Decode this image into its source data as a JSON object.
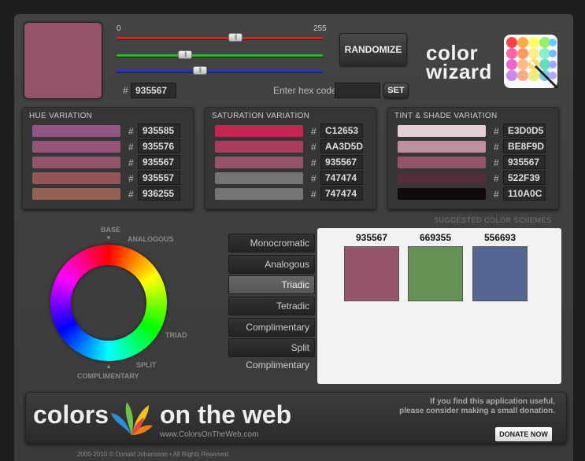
{
  "current": {
    "hex": "935567",
    "color": "#935567"
  },
  "sliders": {
    "min_label": "0",
    "max_label": "255",
    "thumb_glyph": "|||",
    "red": 147,
    "green": 85,
    "blue": 103,
    "colors": {
      "red": "#e02020",
      "green": "#20c020",
      "blue": "#2030d0"
    }
  },
  "controls": {
    "hash": "#",
    "randomize_label": "RANDOMIZE",
    "hex_entry_label": "Enter hex code:",
    "hex_entry_value": "",
    "set_label": "SET"
  },
  "logo": {
    "line1": "color",
    "line2": "wizard"
  },
  "panels": [
    {
      "title": "HUE VARIATION",
      "rows": [
        {
          "hex": "935585",
          "color": "#935585"
        },
        {
          "hex": "935576",
          "color": "#935576"
        },
        {
          "hex": "935567",
          "color": "#935567"
        },
        {
          "hex": "935557",
          "color": "#935557"
        },
        {
          "hex": "936255",
          "color": "#936255"
        }
      ]
    },
    {
      "title": "SATURATION VARIATION",
      "rows": [
        {
          "hex": "C12653",
          "color": "#C12653"
        },
        {
          "hex": "AA3D5D",
          "color": "#AA3D5D"
        },
        {
          "hex": "935567",
          "color": "#935567"
        },
        {
          "hex": "747474",
          "color": "#747474"
        },
        {
          "hex": "747474",
          "color": "#747474"
        }
      ]
    },
    {
      "title": "TINT & SHADE VARIATION",
      "rows": [
        {
          "hex": "E3D0D5",
          "color": "#E3D0D5"
        },
        {
          "hex": "BE8F9D",
          "color": "#BE8F9D"
        },
        {
          "hex": "935567",
          "color": "#935567"
        },
        {
          "hex": "522F39",
          "color": "#522F39"
        },
        {
          "hex": "110A0C",
          "color": "#110A0C"
        }
      ]
    }
  ],
  "wheel_labels": {
    "base": "BASE",
    "analogous": "ANALOGOUS",
    "triad": "TRIAD",
    "split": "SPLIT",
    "complimentary": "COMPLIMENTARY"
  },
  "schemes": {
    "title": "SUGGESTED COLOR SCHEMES",
    "buttons": [
      "Monocromatic",
      "Analogous",
      "Triadic",
      "Tetradic",
      "Complimentary",
      "Split Complimentary"
    ],
    "active": "Triadic",
    "results": [
      {
        "hex": "935567",
        "color": "#935567"
      },
      {
        "hex": "669355",
        "color": "#669355"
      },
      {
        "hex": "556693",
        "color": "#556693"
      }
    ]
  },
  "banner": {
    "word1": "colors",
    "word2": "on the web",
    "url": "www.ColorsOnTheWeb.com",
    "donation_line1": "If you find this application useful,",
    "donation_line2": "please consider making a small donation.",
    "donate_label": "DONATE NOW"
  },
  "footer": "2000-2010 © Donald Johansson • All Rights Reserved"
}
